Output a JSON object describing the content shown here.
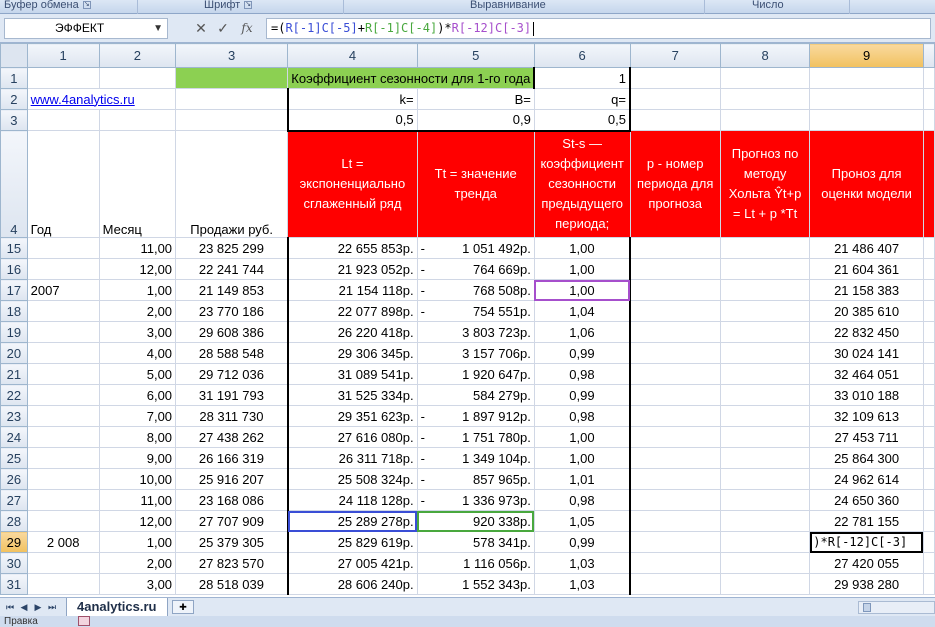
{
  "ribbon": {
    "groups": [
      {
        "label": "Буфер обмена"
      },
      {
        "label": "Шрифт"
      },
      {
        "label": "Выравнивание"
      },
      {
        "label": "Число"
      }
    ]
  },
  "formula_bar": {
    "name_box": "ЭФФЕКТ",
    "cancel_glyph": "✕",
    "enter_glyph": "✓",
    "fx_glyph": "fx",
    "formula_parts": [
      {
        "text": "=(",
        "color": "#000000"
      },
      {
        "text": "R[-1]C[-5]",
        "color": "#3a4ed6"
      },
      {
        "text": "+",
        "color": "#000000"
      },
      {
        "text": "R[-1]C[-4]",
        "color": "#49a83e"
      },
      {
        "text": ")*",
        "color": "#000000"
      },
      {
        "text": "R[-12]C[-3]",
        "color": "#a64fcc"
      }
    ]
  },
  "columns": [
    "1",
    "2",
    "3",
    "4",
    "5",
    "6",
    "7",
    "8",
    "9"
  ],
  "active_column": "9",
  "active_row": "29",
  "row1": {
    "title": "Коэффициент сезонности для 1-го года",
    "value": "1"
  },
  "row2": {
    "link": "www.4analytics.ru",
    "k": "k=",
    "b": "B=",
    "q": "q="
  },
  "row3": {
    "k": "0,5",
    "b": "0,9",
    "q": "0,5"
  },
  "header": {
    "year": "Год",
    "month": "Месяц",
    "sales": "Продажи руб.",
    "lt": "Lt = экспоненциально сглаженный ряд",
    "tt": "Tt = значение тренда",
    "st": "St-s — коэффициент сезонности предыдущего периода;",
    "p": "p - номер периода для прогноза",
    "forecast": "Прогноз по методу Хольта Ŷt+p = Lt + p *Tt",
    "estimate": "Проноз для оценки модели"
  },
  "rows": [
    {
      "n": "15",
      "year": "",
      "month": "11,00",
      "sales": "23 825 299",
      "lt": "22 655 853р.",
      "tt_neg": true,
      "tt": "1 051 492р.",
      "st": "1,00",
      "est": "21 486 407"
    },
    {
      "n": "16",
      "year": "",
      "month": "12,00",
      "sales": "22 241 744",
      "lt": "21 923 052р.",
      "tt_neg": true,
      "tt": "764 669р.",
      "st": "1,00",
      "est": "21 604 361"
    },
    {
      "n": "17",
      "year": "2007",
      "month": "1,00",
      "sales": "21 149 853",
      "lt": "21 154 118р.",
      "tt_neg": true,
      "tt": "768 508р.",
      "st": "1,00",
      "est": "21 158 383"
    },
    {
      "n": "18",
      "year": "",
      "month": "2,00",
      "sales": "23 770 186",
      "lt": "22 077 898р.",
      "tt_neg": true,
      "tt": "754 551р.",
      "st": "1,04",
      "est": "20 385 610"
    },
    {
      "n": "19",
      "year": "",
      "month": "3,00",
      "sales": "29 608 386",
      "lt": "26 220 418р.",
      "tt_neg": false,
      "tt": "3 803 723р.",
      "st": "1,06",
      "est": "22 832 450"
    },
    {
      "n": "20",
      "year": "",
      "month": "4,00",
      "sales": "28 588 548",
      "lt": "29 306 345р.",
      "tt_neg": false,
      "tt": "3 157 706р.",
      "st": "0,99",
      "est": "30 024 141"
    },
    {
      "n": "21",
      "year": "",
      "month": "5,00",
      "sales": "29 712 036",
      "lt": "31 089 541р.",
      "tt_neg": false,
      "tt": "1 920 647р.",
      "st": "0,98",
      "est": "32 464 051"
    },
    {
      "n": "22",
      "year": "",
      "month": "6,00",
      "sales": "31 191 793",
      "lt": "31 525 334р.",
      "tt_neg": false,
      "tt": "584 279р.",
      "st": "0,99",
      "est": "33 010 188"
    },
    {
      "n": "23",
      "year": "",
      "month": "7,00",
      "sales": "28 311 730",
      "lt": "29 351 623р.",
      "tt_neg": true,
      "tt": "1 897 912р.",
      "st": "0,98",
      "est": "32 109 613"
    },
    {
      "n": "24",
      "year": "",
      "month": "8,00",
      "sales": "27 438 262",
      "lt": "27 616 080р.",
      "tt_neg": true,
      "tt": "1 751 780р.",
      "st": "1,00",
      "est": "27 453 711"
    },
    {
      "n": "25",
      "year": "",
      "month": "9,00",
      "sales": "26 166 319",
      "lt": "26 311 718р.",
      "tt_neg": true,
      "tt": "1 349 104р.",
      "st": "1,00",
      "est": "25 864 300"
    },
    {
      "n": "26",
      "year": "",
      "month": "10,00",
      "sales": "25 916 207",
      "lt": "25 508 324р.",
      "tt_neg": true,
      "tt": "857 965р.",
      "st": "1,01",
      "est": "24 962 614"
    },
    {
      "n": "27",
      "year": "",
      "month": "11,00",
      "sales": "23 168 086",
      "lt": "24 118 128р.",
      "tt_neg": true,
      "tt": "1 336 973р.",
      "st": "0,98",
      "est": "24 650 360"
    },
    {
      "n": "28",
      "year": "",
      "month": "12,00",
      "sales": "27 707 909",
      "lt": "25 289 278р.",
      "tt_neg": false,
      "tt": "920 338р.",
      "st": "1,05",
      "est": "22 781 155"
    },
    {
      "n": "29",
      "year": "2 008",
      "month": "1,00",
      "sales": "25 379 305",
      "lt": "25 829 619р.",
      "tt_neg": false,
      "tt": "578 341р.",
      "st": "0,99",
      "est": ")*R[-12]C[-3]"
    },
    {
      "n": "30",
      "year": "",
      "month": "2,00",
      "sales": "27 823 570",
      "lt": "27 005 421р.",
      "tt_neg": false,
      "tt": "1 116 056р.",
      "st": "1,03",
      "est": "27 420 055"
    },
    {
      "n": "31",
      "year": "",
      "month": "3,00",
      "sales": "28 518 039",
      "lt": "28 606 240р.",
      "tt_neg": false,
      "tt": "1 552 343р.",
      "st": "1,03",
      "est": "29 938 280"
    }
  ],
  "sheet_tab": "4analytics.ru",
  "status_text": "Правка"
}
